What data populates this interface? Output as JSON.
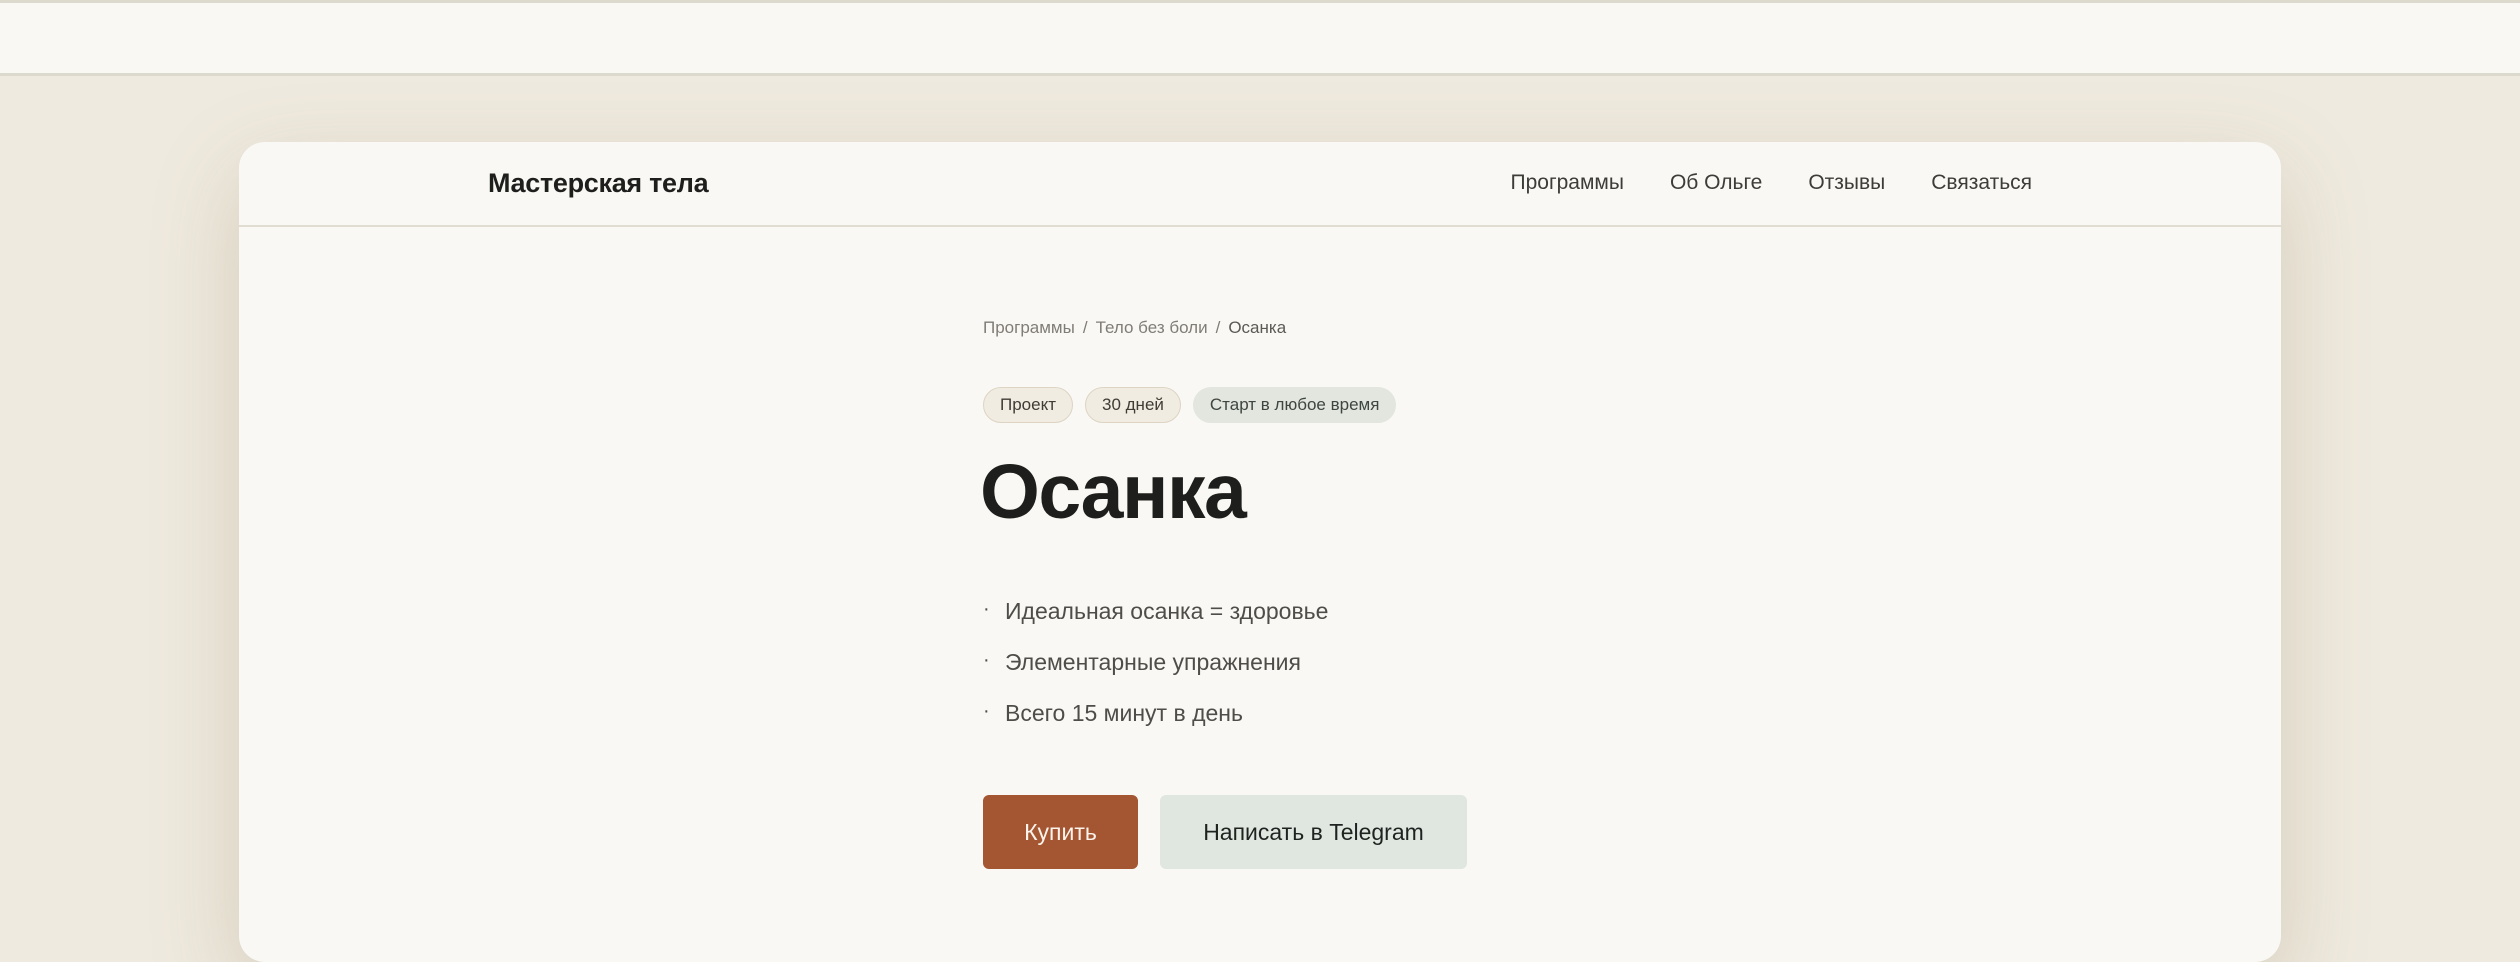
{
  "header": {
    "brand": "Мастерская тела",
    "nav": [
      {
        "label": "Программы"
      },
      {
        "label": "Об Ольге"
      },
      {
        "label": "Отзывы"
      },
      {
        "label": "Связаться"
      }
    ]
  },
  "breadcrumb": {
    "items": [
      "Программы",
      "Тело без боли"
    ],
    "separator": "/",
    "current": "Осанка"
  },
  "tags": [
    "Проект",
    "30 дней",
    "Старт в любое время"
  ],
  "product": {
    "title": "Осанка",
    "bullet_glyph": "·",
    "features": [
      "Идеальная осанка = здоровье",
      "Элементарные упражнения",
      "Всего 15 минут в день"
    ]
  },
  "actions": {
    "buy_label": "Купить",
    "telegram_label": "Написать в Telegram"
  },
  "colors": {
    "accent": "#a45532",
    "secondary_button": "#e0e7e1",
    "page_background": "#efeadf",
    "card_background": "#f9f8f4",
    "text": "#1e1e1c"
  }
}
